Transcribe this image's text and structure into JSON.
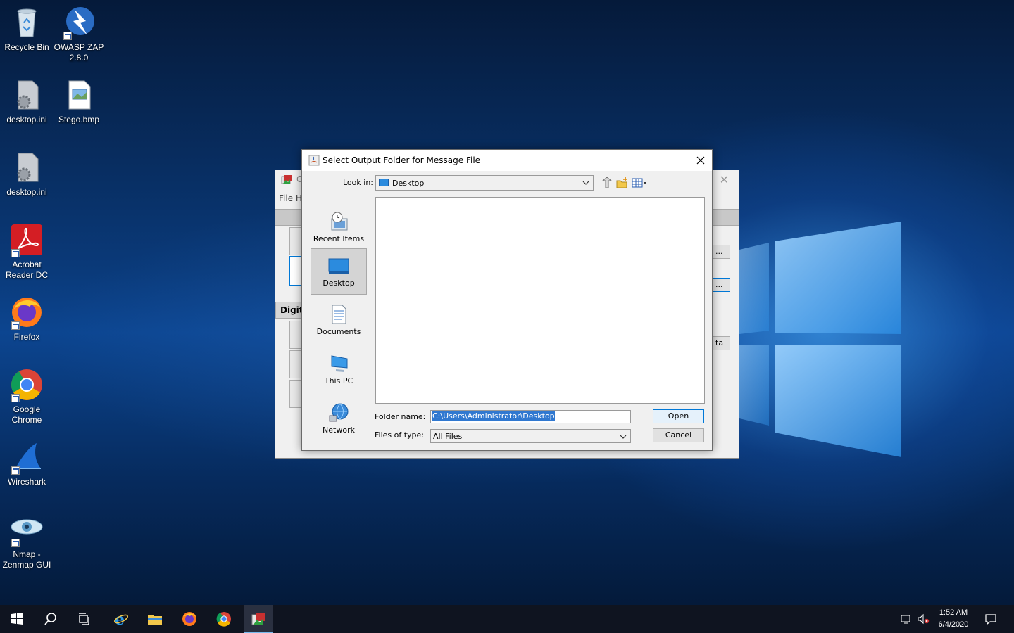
{
  "desktop": {
    "icons": [
      {
        "label": "Recycle Bin",
        "icon": "recycle-bin-icon"
      },
      {
        "label": "OWASP ZAP 2.8.0",
        "icon": "owasp-zap-icon"
      },
      {
        "label": "desktop.ini",
        "icon": "settings-file-icon"
      },
      {
        "label": "Stego.bmp",
        "icon": "bitmap-file-icon"
      },
      {
        "label": "desktop.ini",
        "icon": "settings-file-icon"
      },
      {
        "label": "Acrobat Reader DC",
        "icon": "acrobat-icon"
      },
      {
        "label": "Firefox",
        "icon": "firefox-icon"
      },
      {
        "label": "Google Chrome",
        "icon": "chrome-icon"
      },
      {
        "label": "Wireshark",
        "icon": "wireshark-icon"
      },
      {
        "label": "Nmap - Zenmap GUI",
        "icon": "nmap-icon"
      }
    ]
  },
  "bg_window": {
    "title_fragment": "O",
    "menu": "File H",
    "section_fragment": "Digita",
    "btn1": "...",
    "btn2": "...",
    "btn3": "ta"
  },
  "dialog": {
    "title": "Select Output Folder for Message File",
    "look_in_label": "Look in:",
    "look_in_value": "Desktop",
    "places": [
      {
        "label": "Recent Items"
      },
      {
        "label": "Desktop"
      },
      {
        "label": "Documents"
      },
      {
        "label": "This PC"
      },
      {
        "label": "Network"
      }
    ],
    "folder_name_label": "Folder name:",
    "folder_name_value": "C:\\Users\\Administrator\\Desktop",
    "files_of_type_label": "Files of type:",
    "files_of_type_value": "All Files",
    "open_label": "Open",
    "cancel_label": "Cancel"
  },
  "taskbar": {
    "time": "1:52 AM",
    "date": "6/4/2020"
  },
  "colors": {
    "accent": "#0078d7",
    "selection": "#3078d0",
    "taskbar": "#0f1420"
  }
}
